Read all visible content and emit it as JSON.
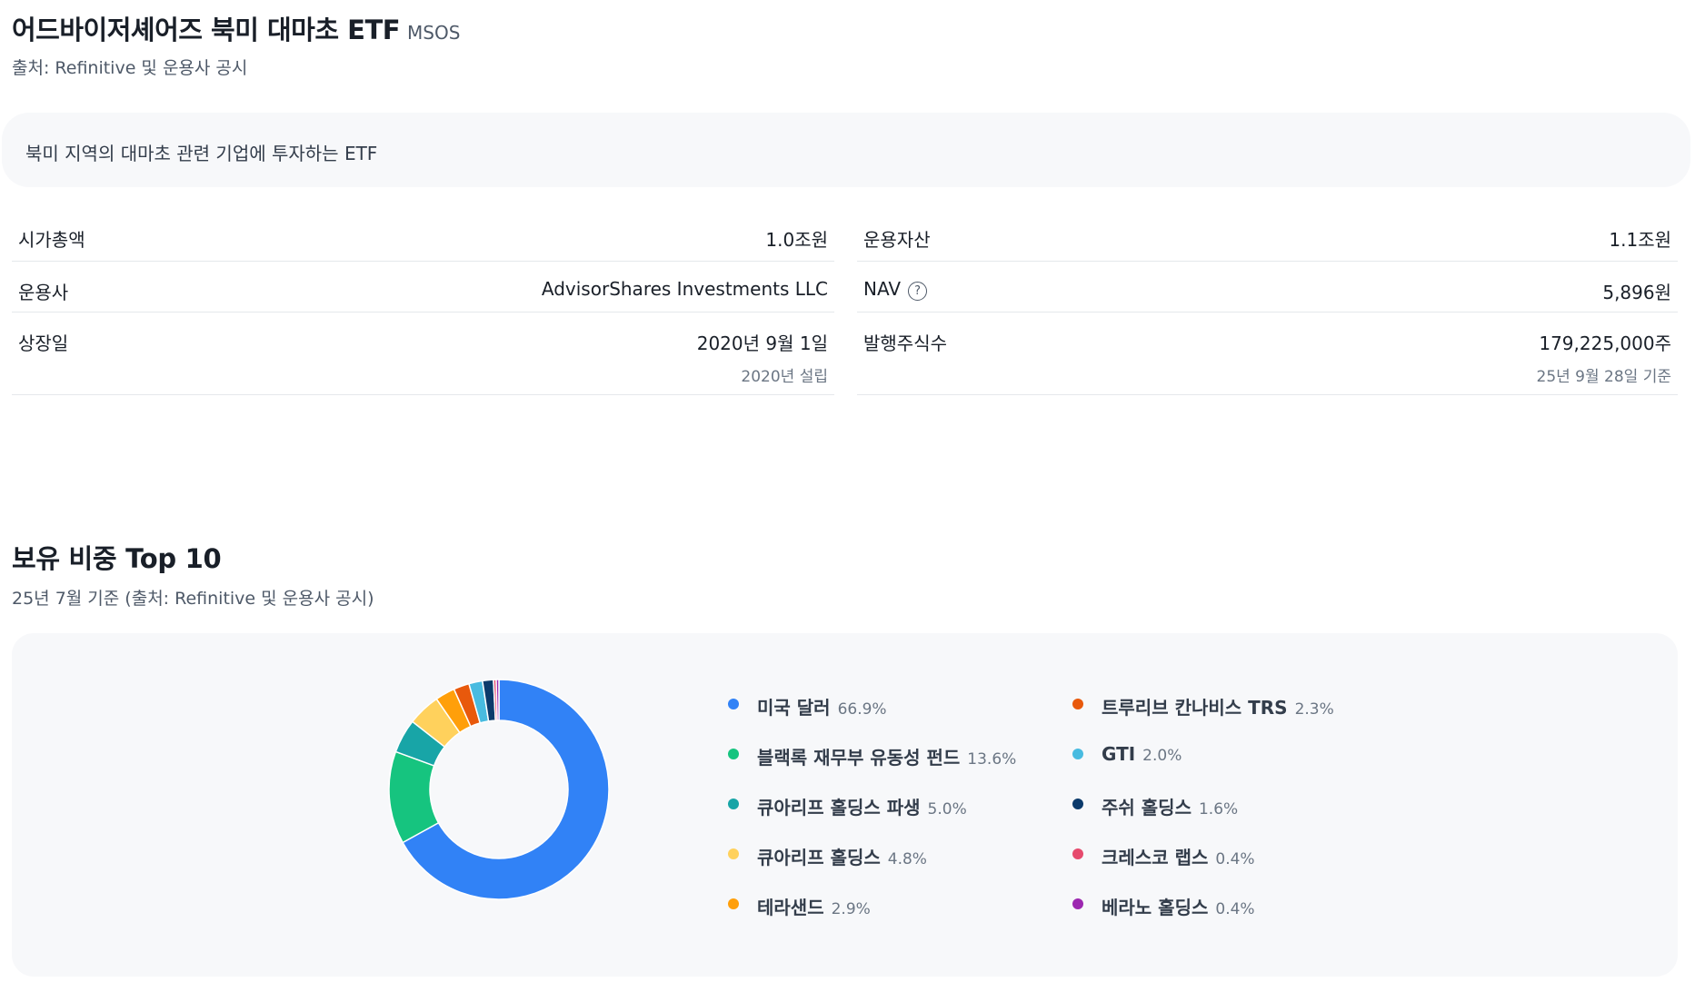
{
  "header": {
    "title": "어드바이저셰어즈 북미 대마초 ETF",
    "ticker": "MSOS",
    "source": "출처: Refinitive 및 운용사 공시"
  },
  "description": "북미 지역의 대마초 관련 기업에 투자하는 ETF",
  "info": {
    "left": [
      {
        "label": "시가총액",
        "value": "1.0조원"
      },
      {
        "label": "운용사",
        "value": "AdvisorShares Investments LLC"
      },
      {
        "label": "상장일",
        "value": "2020년 9월 1일",
        "sub": "2020년 설립"
      }
    ],
    "right": [
      {
        "label": "운용자산",
        "value": "1.1조원"
      },
      {
        "label": "NAV",
        "value": "5,896원",
        "help_icon": "question-circle-icon"
      },
      {
        "label": "발행주식수",
        "value": "179,225,000주",
        "sub": "25년 9월 28일 기준"
      }
    ]
  },
  "holdings": {
    "title": "보유 비중 Top 10",
    "subtitle": "25년 7월 기준 (출처: Refinitive 및 운용사 공시)"
  },
  "chart_data": {
    "type": "pie",
    "donut": true,
    "slices": [
      {
        "name": "미국 달러",
        "pct_label": "66.9%",
        "value": 66.9,
        "color": "#3182f6"
      },
      {
        "name": "블랙록 재무부 유동성 펀드",
        "pct_label": "13.6%",
        "value": 13.6,
        "color": "#16c47f"
      },
      {
        "name": "큐아리프 홀딩스 파생",
        "pct_label": "5.0%",
        "value": 5.0,
        "color": "#18a5a7"
      },
      {
        "name": "큐아리프 홀딩스",
        "pct_label": "4.8%",
        "value": 4.8,
        "color": "#ffd15c"
      },
      {
        "name": "테라샌드",
        "pct_label": "2.9%",
        "value": 2.9,
        "color": "#ff9f0a"
      },
      {
        "name": "트루리브 칸나비스 TRS",
        "pct_label": "2.3%",
        "value": 2.3,
        "color": "#e8590c"
      },
      {
        "name": "GTI",
        "pct_label": "2.0%",
        "value": 2.0,
        "color": "#48bbe0"
      },
      {
        "name": "주쉬 홀딩스",
        "pct_label": "1.6%",
        "value": 1.6,
        "color": "#0b3a6b"
      },
      {
        "name": "크레스코 랩스",
        "pct_label": "0.4%",
        "value": 0.4,
        "color": "#e64a6d"
      },
      {
        "name": "베라노 홀딩스",
        "pct_label": "0.4%",
        "value": 0.4,
        "color": "#9c27b0"
      }
    ]
  }
}
